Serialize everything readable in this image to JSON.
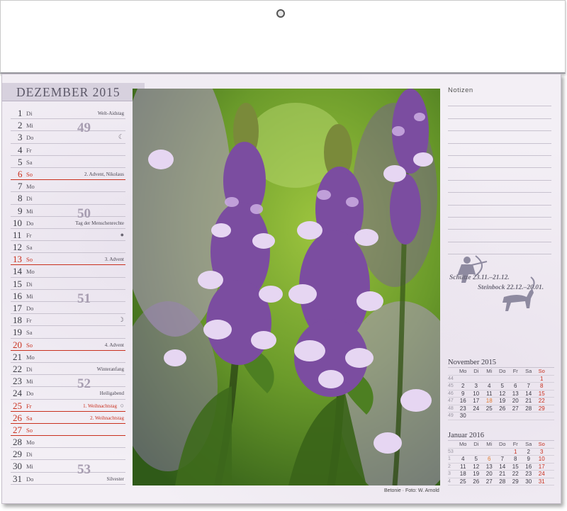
{
  "month_title": "DEZEMBER 2015",
  "days": [
    {
      "d": "1",
      "wd": "Di",
      "ev": "Welt-Aidstag"
    },
    {
      "d": "2",
      "wd": "Mi",
      "ev": ""
    },
    {
      "d": "3",
      "wd": "Do",
      "ev": "",
      "moon": "☾"
    },
    {
      "d": "4",
      "wd": "Fr",
      "ev": ""
    },
    {
      "d": "5",
      "wd": "Sa",
      "ev": ""
    },
    {
      "d": "6",
      "wd": "So",
      "ev": "2. Advent, Nikolaus",
      "sun": true
    },
    {
      "d": "7",
      "wd": "Mo",
      "ev": ""
    },
    {
      "d": "8",
      "wd": "Di",
      "ev": ""
    },
    {
      "d": "9",
      "wd": "Mi",
      "ev": ""
    },
    {
      "d": "10",
      "wd": "Do",
      "ev": "Tag der Menschenrechte"
    },
    {
      "d": "11",
      "wd": "Fr",
      "ev": "",
      "moon": "●"
    },
    {
      "d": "12",
      "wd": "Sa",
      "ev": ""
    },
    {
      "d": "13",
      "wd": "So",
      "ev": "3. Advent",
      "sun": true
    },
    {
      "d": "14",
      "wd": "Mo",
      "ev": ""
    },
    {
      "d": "15",
      "wd": "Di",
      "ev": ""
    },
    {
      "d": "16",
      "wd": "Mi",
      "ev": ""
    },
    {
      "d": "17",
      "wd": "Do",
      "ev": ""
    },
    {
      "d": "18",
      "wd": "Fr",
      "ev": "",
      "moon": "☽"
    },
    {
      "d": "19",
      "wd": "Sa",
      "ev": ""
    },
    {
      "d": "20",
      "wd": "So",
      "ev": "4. Advent",
      "sun": true
    },
    {
      "d": "21",
      "wd": "Mo",
      "ev": ""
    },
    {
      "d": "22",
      "wd": "Di",
      "ev": "Winteranfang"
    },
    {
      "d": "23",
      "wd": "Mi",
      "ev": ""
    },
    {
      "d": "24",
      "wd": "Do",
      "ev": "Heiligabend"
    },
    {
      "d": "25",
      "wd": "Fr",
      "ev": "1. Weihnachtstag",
      "hol": true,
      "moon": "○"
    },
    {
      "d": "26",
      "wd": "Sa",
      "ev": "2. Weihnachtstag",
      "hol": true
    },
    {
      "d": "27",
      "wd": "So",
      "ev": "",
      "sun": true
    },
    {
      "d": "28",
      "wd": "Mo",
      "ev": ""
    },
    {
      "d": "29",
      "wd": "Di",
      "ev": ""
    },
    {
      "d": "30",
      "wd": "Mi",
      "ev": ""
    },
    {
      "d": "31",
      "wd": "Do",
      "ev": "Silvester"
    }
  ],
  "week_numbers": [
    {
      "kw": "49",
      "row": 1
    },
    {
      "kw": "50",
      "row": 8
    },
    {
      "kw": "51",
      "row": 15
    },
    {
      "kw": "52",
      "row": 22
    },
    {
      "kw": "53",
      "row": 29
    }
  ],
  "photo_caption": "Betonie · Foto: W. Arnold",
  "notes_title": "Notizen",
  "zodiac": {
    "line1": "Schütze 23.11.–21.12.",
    "line2": "Steinbock 22.12.–20.01."
  },
  "mini_calendars": [
    {
      "title": "November 2015",
      "headers": [
        "Mo",
        "Di",
        "Mi",
        "Do",
        "Fr",
        "Sa",
        "So"
      ],
      "weeks": [
        {
          "wk": "44",
          "days": [
            "",
            "",
            "",
            "",
            "",
            "",
            "1"
          ]
        },
        {
          "wk": "45",
          "days": [
            "2",
            "3",
            "4",
            "5",
            "6",
            "7",
            "8"
          ]
        },
        {
          "wk": "46",
          "days": [
            "9",
            "10",
            "11",
            "12",
            "13",
            "14",
            "15"
          ]
        },
        {
          "wk": "47",
          "days": [
            "16",
            "17",
            "18",
            "19",
            "20",
            "21",
            "22"
          ]
        },
        {
          "wk": "48",
          "days": [
            "23",
            "24",
            "25",
            "26",
            "27",
            "28",
            "29"
          ]
        },
        {
          "wk": "49",
          "days": [
            "30",
            "",
            "",
            "",
            "",
            "",
            ""
          ]
        }
      ],
      "holidays": [
        "18"
      ]
    },
    {
      "title": "Januar 2016",
      "headers": [
        "Mo",
        "Di",
        "Mi",
        "Do",
        "Fr",
        "Sa",
        "So"
      ],
      "weeks": [
        {
          "wk": "53",
          "days": [
            "",
            "",
            "",
            "",
            "1",
            "2",
            "3"
          ]
        },
        {
          "wk": "1",
          "days": [
            "4",
            "5",
            "6",
            "7",
            "8",
            "9",
            "10"
          ]
        },
        {
          "wk": "2",
          "days": [
            "11",
            "12",
            "13",
            "14",
            "15",
            "16",
            "17"
          ]
        },
        {
          "wk": "3",
          "days": [
            "18",
            "19",
            "20",
            "21",
            "22",
            "23",
            "24"
          ]
        },
        {
          "wk": "4",
          "days": [
            "25",
            "26",
            "27",
            "28",
            "29",
            "30",
            "31"
          ]
        }
      ],
      "holidays": [
        "1",
        "6"
      ]
    }
  ],
  "colors": {
    "accent_red": "#c9301e",
    "tab": "#d7d1de",
    "week_number": "#a79db1"
  }
}
